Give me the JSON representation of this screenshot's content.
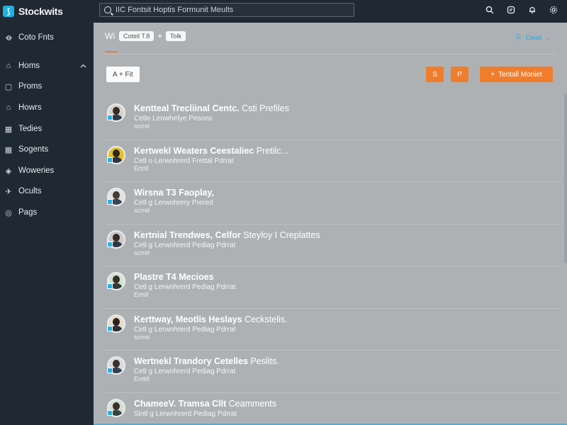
{
  "app": {
    "name": "Stockwits",
    "logo_glyph": "⟆"
  },
  "search": {
    "placeholder": "IIC Fontsit Hoptis Formunit Meults"
  },
  "top_icons": [
    "search-icon",
    "message-icon",
    "notification-icon",
    "settings-icon"
  ],
  "sidebar": {
    "header_label": "Coto Fnts",
    "items": [
      {
        "label": "Homs",
        "icon": "home-icon",
        "glyph": "⌂",
        "expanded": true
      },
      {
        "label": "Proms",
        "icon": "chat-icon",
        "glyph": "▢"
      },
      {
        "label": "Howrs",
        "icon": "bookmark-icon",
        "glyph": "⌂"
      },
      {
        "label": "Tedies",
        "icon": "calendar-icon",
        "glyph": "▦"
      },
      {
        "label": "Sogents",
        "icon": "grid-icon",
        "glyph": "▦"
      },
      {
        "label": "Woweries",
        "icon": "shield-icon",
        "glyph": "◈"
      },
      {
        "label": "Ocults",
        "icon": "rocket-icon",
        "glyph": "✈"
      },
      {
        "label": "Pags",
        "icon": "target-icon",
        "glyph": "◎"
      }
    ]
  },
  "tabs": {
    "main": "Wi",
    "chip_1": "Coteil T.8",
    "separator": "▾",
    "chip_2": "Tolk"
  },
  "sort": {
    "label": "Coud",
    "icon_glyph": "⎘",
    "chevron": "⌄"
  },
  "toolbar": {
    "add_filter": "A + Fit",
    "btn_1": "S",
    "btn_2": "P",
    "cta": "Tentall Moniet",
    "cta_glyph": "+"
  },
  "posts": [
    {
      "title": "Kentteal Trecliinal Centc.",
      "title_rest": " Csti Prefiles",
      "sub": "Cetle Lenwhefye Pesons",
      "meta": "scrrel",
      "avatar_bg": "#d7d2cd",
      "head": "#3a2b25",
      "shirt": "#2e3947"
    },
    {
      "title": "Kertwekl Weaters Ceestaliec",
      "title_rest": " Pretilc...",
      "sub": "Cetl o Lerwnhrerd Frettal Pdrrat",
      "meta": "Ertrill",
      "avatar_bg": "#e4c12a",
      "head": "#2d2621",
      "shirt": "#2b3440"
    },
    {
      "title": "Wirsna T3 Faoplay,",
      "title_rest": "",
      "sub": "Cetl g Lerwnhrery Prered",
      "meta": "scrrel",
      "avatar_bg": "#dfe2e4",
      "head": "#4a3a32",
      "shirt": "#394554"
    },
    {
      "title": "Kertnial Trendwes, Celfor",
      "title_rest": " Steyloy I Creplattes",
      "sub": "Cetl g Lerwnhrerd Pediag Pdrrat",
      "meta": "scrrel",
      "avatar_bg": "#c8cacb",
      "head": "#3a2c24",
      "shirt": "#2d3745"
    },
    {
      "title": "Plastre T4 Mecioes",
      "title_rest": "",
      "sub": "Cetl g Lerwnhrerd Pediag Pdrrat",
      "meta": "Ertrill",
      "avatar_bg": "#cfe3d3",
      "head": "#3b2e27",
      "shirt": "#2f3c36"
    },
    {
      "title": "Kerttway, Meotlis Heslays",
      "title_rest": " Ceckstelis.",
      "sub": "Cetl g Lerwnhrerd Pediag Pdrrat",
      "meta": "scrrel",
      "avatar_bg": "#e6dcc8",
      "head": "#2a211d",
      "shirt": "#2c2f33"
    },
    {
      "title": "Wertnekl Trandory Cetelles",
      "title_rest": " Peslits.",
      "sub": "Cetl g Lerwnhrerd Pediag Pdrrat",
      "meta": "Enttill",
      "avatar_bg": "#d9dbde",
      "head": "#3d3029",
      "shirt": "#314055"
    },
    {
      "title": "ChameeV. Tramsa Cllt",
      "title_rest": " Ceamments",
      "sub": "Sintl g Lerwnhrerd Pediag Pdrrat",
      "meta": "",
      "avatar_bg": "#d2e0d6",
      "head": "#3c2f29",
      "shirt": "#354444"
    }
  ]
}
